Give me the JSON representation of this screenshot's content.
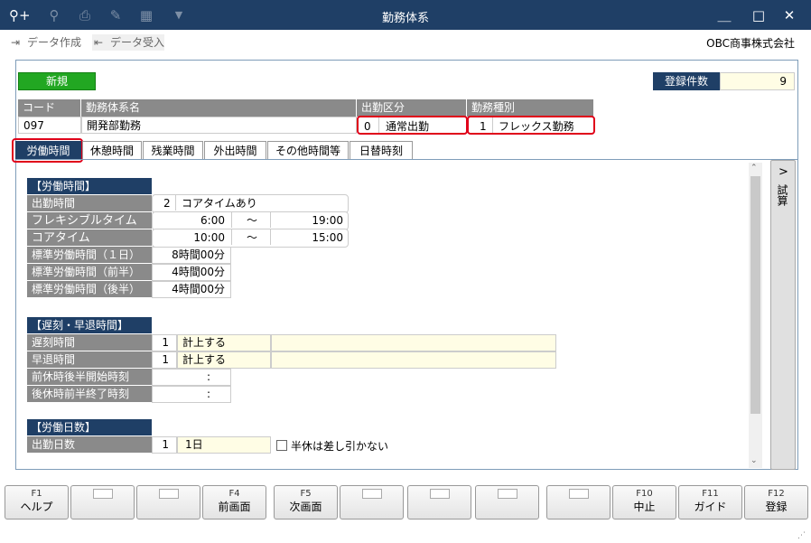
{
  "window": {
    "title": "勤務体系",
    "minimize": "＿",
    "maximize": "□",
    "close": "✕"
  },
  "toolbar": {
    "create_data": "データ作成",
    "receive_data": "データ受入",
    "company": "OBC商事株式会社"
  },
  "new_button": "新規",
  "record_count": {
    "label": "登録件数",
    "value": "9"
  },
  "header_table": {
    "code_label": "コード",
    "name_label": "勤務体系名",
    "attendance_label": "出勤区分",
    "work_type_label": "勤務種別",
    "code": "097",
    "name": "開発部勤務",
    "attendance_num": "0",
    "attendance_text": "通常出勤",
    "work_type_num": "1",
    "work_type_text": "フレックス勤務"
  },
  "tabs": [
    "労働時間",
    "休憩時間",
    "残業時間",
    "外出時間",
    "その他時間等",
    "日替時刻"
  ],
  "labor_section": {
    "title": "【労働時間】",
    "attendance_time_label": "出勤時間",
    "attendance_time_num": "2",
    "attendance_time_text": "コアタイムあり",
    "flex_label": "フレキシブルタイム",
    "flex_start": "6:00",
    "flex_sep": "～",
    "flex_end": "19:00",
    "core_label": "コアタイム",
    "core_start": "10:00",
    "core_sep": "～",
    "core_end": "15:00",
    "std_day_label": "標準労働時間（１日）",
    "std_day": "8時間00分",
    "std_first_label": "標準労働時間（前半）",
    "std_first": "4時間00分",
    "std_second_label": "標準労働時間（後半）",
    "std_second": "4時間00分"
  },
  "late_section": {
    "title": "【遅刻・早退時間】",
    "late_label": "遅刻時間",
    "late_num": "1",
    "late_text": "計上する",
    "early_label": "早退時間",
    "early_num": "1",
    "early_text": "計上する",
    "pm_off_label": "前休時後半開始時刻",
    "pm_off_value": ":",
    "am_off_label": "後休時前半終了時刻",
    "am_off_value": ":"
  },
  "days_section": {
    "title": "【労働日数】",
    "days_label": "出勤日数",
    "days_num": "1",
    "days_text": "1日",
    "half_checkbox_label": "半休は差し引かない"
  },
  "side_button": {
    "arrow": ">",
    "label": "試算"
  },
  "fkeys": [
    {
      "key": "F1",
      "label": "ヘルプ"
    },
    {
      "key": "",
      "label": ""
    },
    {
      "key": "",
      "label": ""
    },
    {
      "key": "F4",
      "label": "前画面"
    },
    {
      "key": "F5",
      "label": "次画面"
    },
    {
      "key": "",
      "label": ""
    },
    {
      "key": "",
      "label": ""
    },
    {
      "key": "",
      "label": ""
    },
    {
      "key": "",
      "label": ""
    },
    {
      "key": "F10",
      "label": "中止"
    },
    {
      "key": "F11",
      "label": "ガイド"
    },
    {
      "key": "F12",
      "label": "登録"
    }
  ]
}
